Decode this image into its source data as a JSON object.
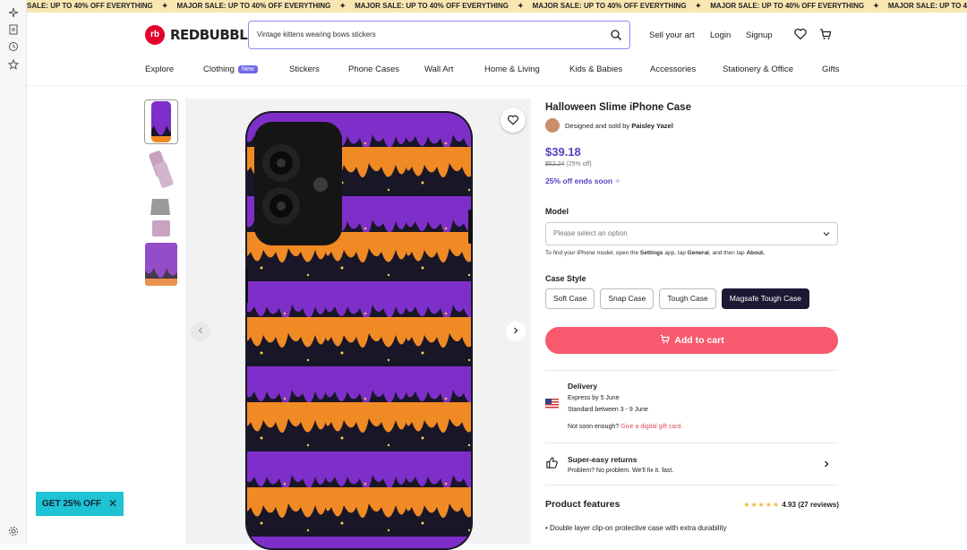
{
  "banner": {
    "first": "SALE: UP TO 40% OFF EVERYTHING",
    "text": "MAJOR SALE: UP TO 40% OFF EVERYTHING",
    "separator": "✦"
  },
  "header": {
    "logo": "REDBUBBLE",
    "logo_mark": "rb",
    "search_value": "Vintage kittens wearing bows stickers",
    "sell_label": "Sell your art",
    "login_label": "Login",
    "signup_label": "Signup"
  },
  "nav": {
    "items": [
      "Explore",
      "Clothing",
      "Stickers",
      "Phone Cases",
      "Wall Art",
      "Home & Living",
      "Kids & Babies",
      "Accessories",
      "Stationery & Office",
      "Gifts"
    ],
    "new_badge": "New"
  },
  "product": {
    "title": "Halloween Slime iPhone Case",
    "designed_by": "Designed and sold by",
    "artist": "Paisley Yazel",
    "price": "$39.18",
    "original_price": "$52.24",
    "discount": "(25% off)",
    "sale_ends": "25% off ends soon",
    "model_label": "Model",
    "model_placeholder": "Please select an option",
    "model_hint_1": "To find your iPhone model, open the ",
    "model_hint_settings": "Settings",
    "model_hint_2": " app, tap ",
    "model_hint_general": "General",
    "model_hint_3": ", and then tap ",
    "model_hint_about": "About.",
    "case_style_label": "Case Style",
    "case_styles": [
      "Soft Case",
      "Snap Case",
      "Tough Case",
      "Magsafe Tough Case"
    ],
    "selected_style": "Magsafe Tough Case",
    "add_to_cart": "Add to cart"
  },
  "delivery": {
    "title": "Delivery",
    "express": "Express by 5 June",
    "standard": "Standard between 3 - 9 June",
    "not_soon": "Not soon enough?",
    "gift_link": "Give a digital gift card."
  },
  "returns": {
    "title": "Super-easy returns",
    "text": "Problem? No problem. We'll fix it. fast."
  },
  "features": {
    "title": "Product features",
    "rating": "4.93",
    "reviews": "(27 reviews)",
    "stars": 5,
    "first_bullet": "Double layer clip-on protective case with extra durability"
  },
  "promo": {
    "label": "GET 25% OFF",
    "close": "✕"
  },
  "colors": {
    "accent": "#5b3fbf",
    "cart": "#f75a6e",
    "promo": "#1fc3d4",
    "selected": "#1b1933",
    "sale_banner": "#f8e7b3"
  }
}
